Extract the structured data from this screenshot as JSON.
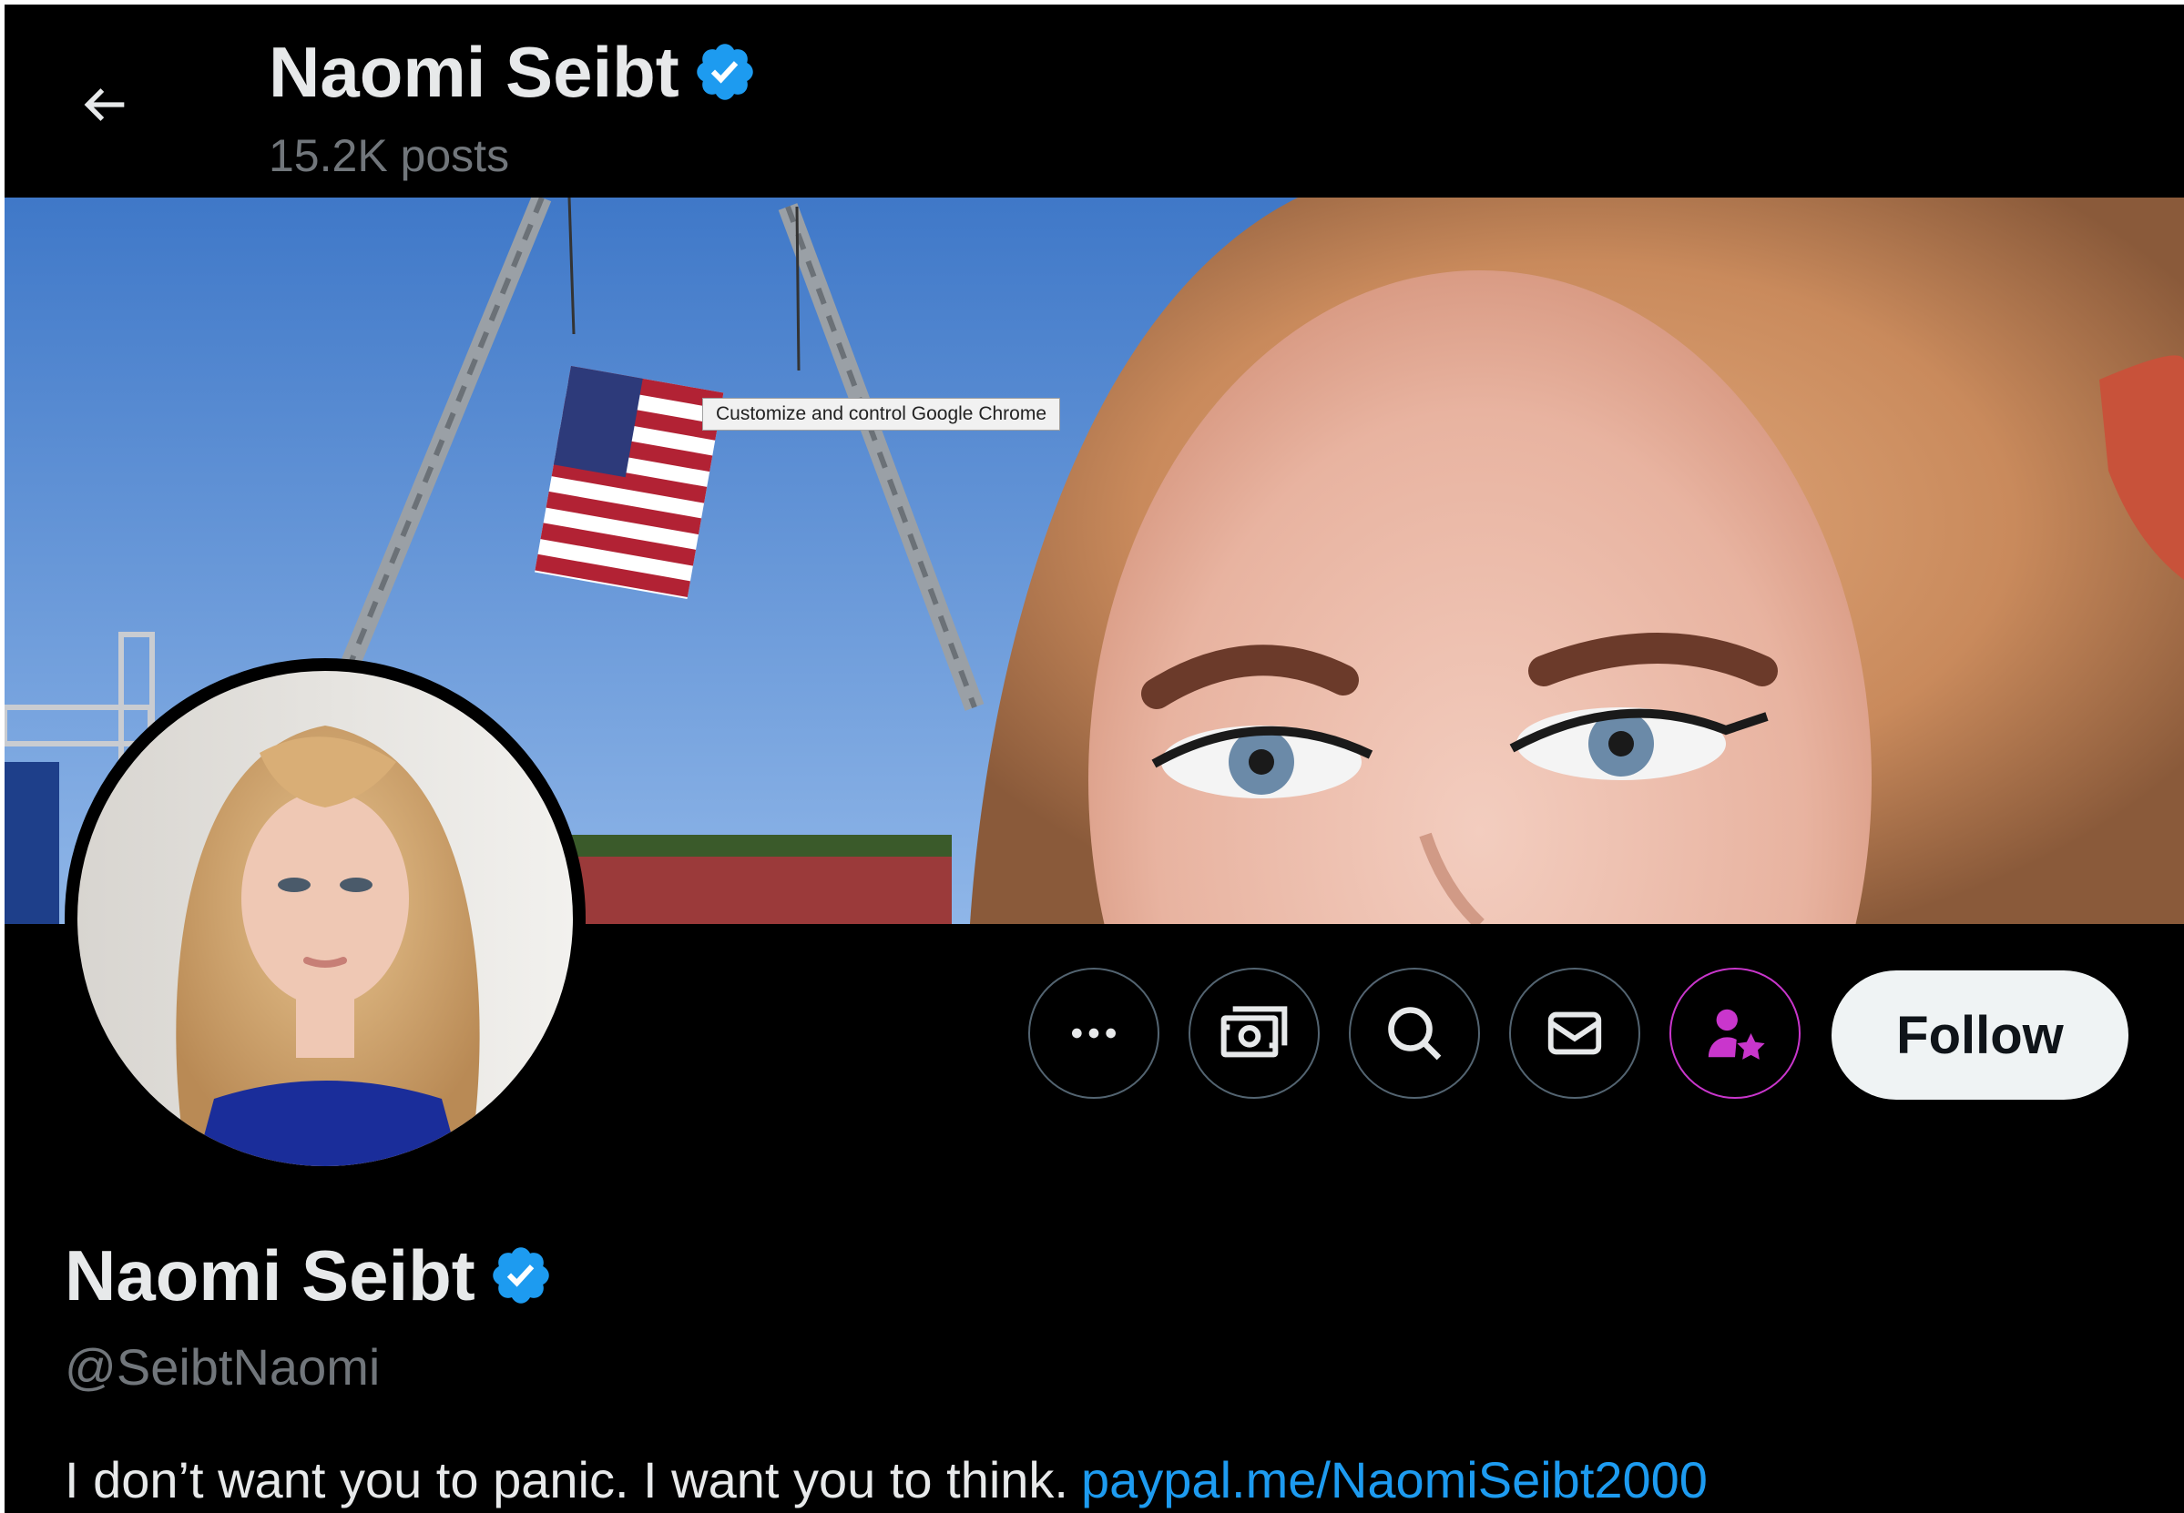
{
  "header": {
    "display_name": "Naomi Seibt",
    "post_count": "15.2K posts"
  },
  "banner": {
    "tooltip": "Customize and control Google Chrome"
  },
  "actions": {
    "follow_label": "Follow"
  },
  "profile": {
    "display_name": "Naomi Seibt",
    "handle": "@SeibtNaomi",
    "bio_text": "I don’t want you to panic. I want you to think.",
    "bio_link": "paypal.me/NaomiSeibt2000"
  },
  "icons": {
    "back": "arrow-left-icon",
    "verified": "verified-badge-icon",
    "more": "more-icon",
    "tip": "money-icon",
    "search": "search-icon",
    "message": "envelope-icon",
    "subscribe": "person-star-icon"
  },
  "colors": {
    "background": "#000000",
    "primary_text": "#e7e9ea",
    "secondary_text": "#71767b",
    "accent_blue": "#1d9bf0",
    "verified_blue": "#1d9bf0",
    "subscribe_purple": "#c936cc",
    "button_border": "#536471"
  }
}
